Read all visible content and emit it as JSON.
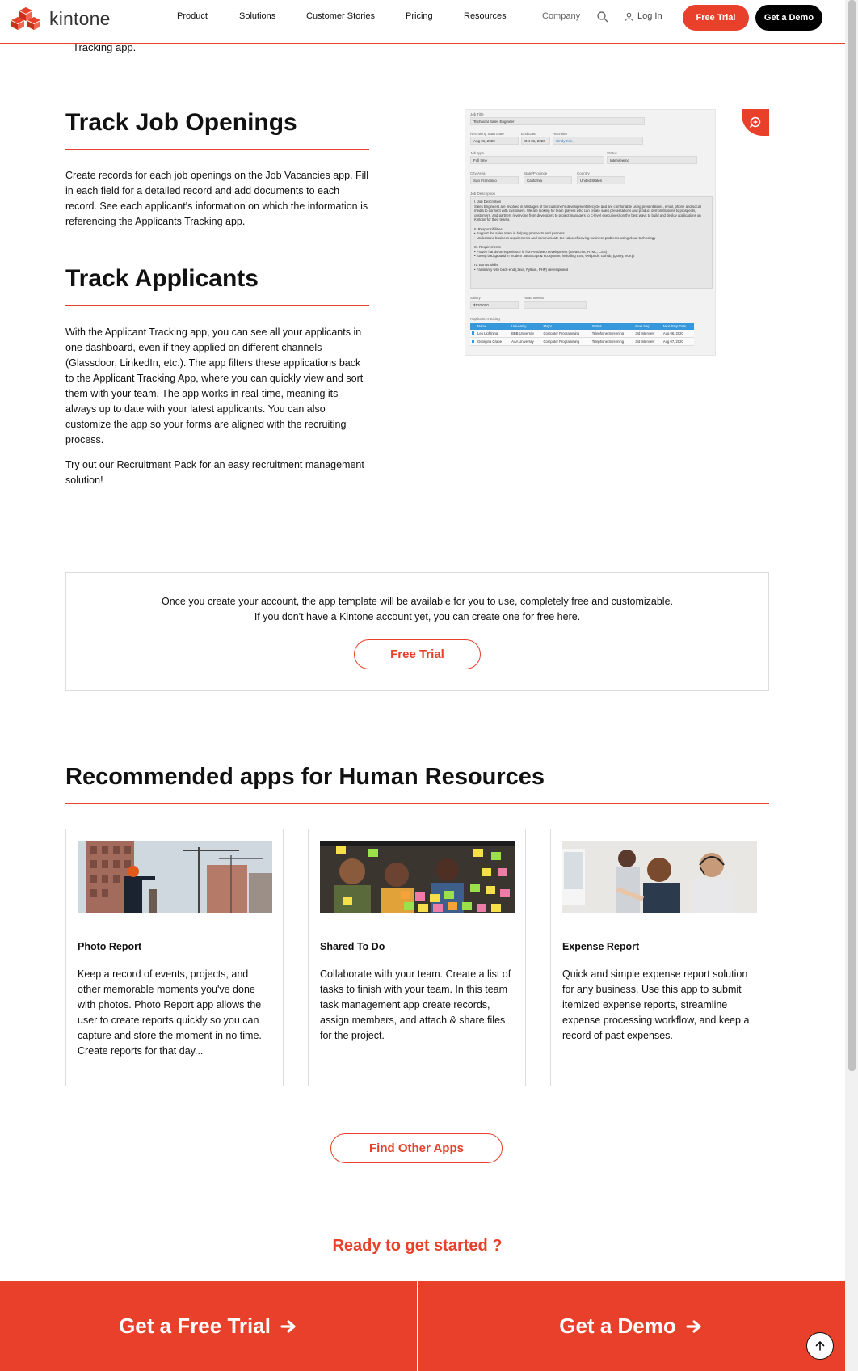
{
  "header": {
    "brand": "kintone",
    "nav": [
      {
        "label": "Product"
      },
      {
        "label": "Solutions"
      },
      {
        "label": "Customer Stories"
      },
      {
        "label": "Pricing"
      },
      {
        "label": "Resources"
      },
      {
        "label": "Company"
      }
    ],
    "login": "Log In",
    "free_trial": "Free Trial",
    "get_demo": "Get a Demo",
    "accent": "#e8402a"
  },
  "cut_text": "Tracking app.",
  "job_openings": {
    "title": "Track Job Openings",
    "body": "Create records for each job openings on the Job Vacancies app. Fill in each field for a detailed record and add documents to each record. See each applicant's information on which the information is referencing the Applicants Tracking app."
  },
  "applicants": {
    "title": "Track Applicants",
    "body1": "With the Applicant Tracking app, you can see all your applicants in one dashboard, even if they applied on different channels (Glassdoor, LinkedIn, etc.). The app filters these applications back to the Applicant Tracking App, where you can quickly view and sort them with your team. The app works in real-time, meaning its always up to date with your latest applicants. You can also customize the app so your forms are aligned with the recruiting process.",
    "body2": "Try out our Recruitment Pack for an easy recruitment management solution!"
  },
  "mock": {
    "job_title_label": "Job Title",
    "job_title": "Technical Sales Engineer",
    "start_label": "Recruiting Start Date",
    "start": "Aug 01, 2020",
    "end_label": "End Date",
    "end": "Oct 31, 2020",
    "recruiter_label": "Recruiter",
    "recruiter": "Cindy Kim",
    "job_type_label": "Job type",
    "job_type": "Full time",
    "status_label": "Status",
    "status": "Interviewing",
    "city_label": "City/Area",
    "city": "San Francisco",
    "state_label": "State/Province",
    "state": "California",
    "country_label": "Country",
    "country": "United States",
    "desc_label": "Job Description",
    "desc": "I. Job Description\nSales Engineers are involved in all stages of the customer's development lifecycle and are comfortable using presentations, email, phone and social media to connect with customers. We are looking for team players who can create sales presentations and product demonstrations to prospects, customers, and partners (everyone from developers to project managers to C-level executives) on the best ways to build and deploy applications on Kintone for their teams.\n\nII. Responsibilities\n• Support the sales team in helping prospects and partners\n• Understand business requirements and communicate the value of solving business problems using cloud technology\n\nIII. Requirements\n• Proven hands-on experience in front-end web development (Javascript, HTML, CSS)\n• Strong background in modern JavaScript & ecosystem, including ES6, webpack, Github, jQuery, Vue.js\n\nIV. Bonus Skills\n• Familiarity with back-end (Java, Python, PHP) development",
    "salary_label": "Salary",
    "salary": "$120,000",
    "attach_label": "Attachments",
    "tracking_label": "Applicant Tracking",
    "table_headers": [
      "Name",
      "University",
      "Major",
      "Status",
      "Next Step",
      "Next Step Date"
    ],
    "table_rows": [
      [
        "Leo Lightning",
        "BBB University",
        "Computer Programming",
        "Telephone Screening",
        "3rd Interview",
        "Aug 06, 2020"
      ],
      [
        "Georgina Grape",
        "AAA University",
        "Computer Programming",
        "Telephone Screening",
        "3rd Interview",
        "Aug 07, 2020"
      ]
    ]
  },
  "notice": {
    "line1": "Once you create your account, the app template will be available for you to use, completely free and customizable.",
    "line2": "If you don't have a Kintone account yet, you can create one for free here.",
    "button": "Free Trial"
  },
  "recommended": {
    "title": "Recommended apps for Human Resources",
    "cards": [
      {
        "title": "Photo Report",
        "desc": "Keep a record of events, projects, and other memorable moments you've done with photos. Photo Report app allows the user to create reports quickly so you can capture and store the moment in no time. Create reports for that day..."
      },
      {
        "title": "Shared To Do",
        "desc": "Collaborate with your team. Create a list of tasks to finish with your team. In this team task management app create records, assign members, and attach & share files for the project."
      },
      {
        "title": "Expense Report",
        "desc": "Quick and simple expense report solution for any business. Use this app to submit itemized expense reports, streamline expense processing workflow, and keep a record of past expenses."
      }
    ],
    "find_button": "Find Other Apps"
  },
  "ready": "Ready to get started ?",
  "cta": {
    "trial": "Get a Free Trial",
    "demo": "Get a Demo"
  }
}
